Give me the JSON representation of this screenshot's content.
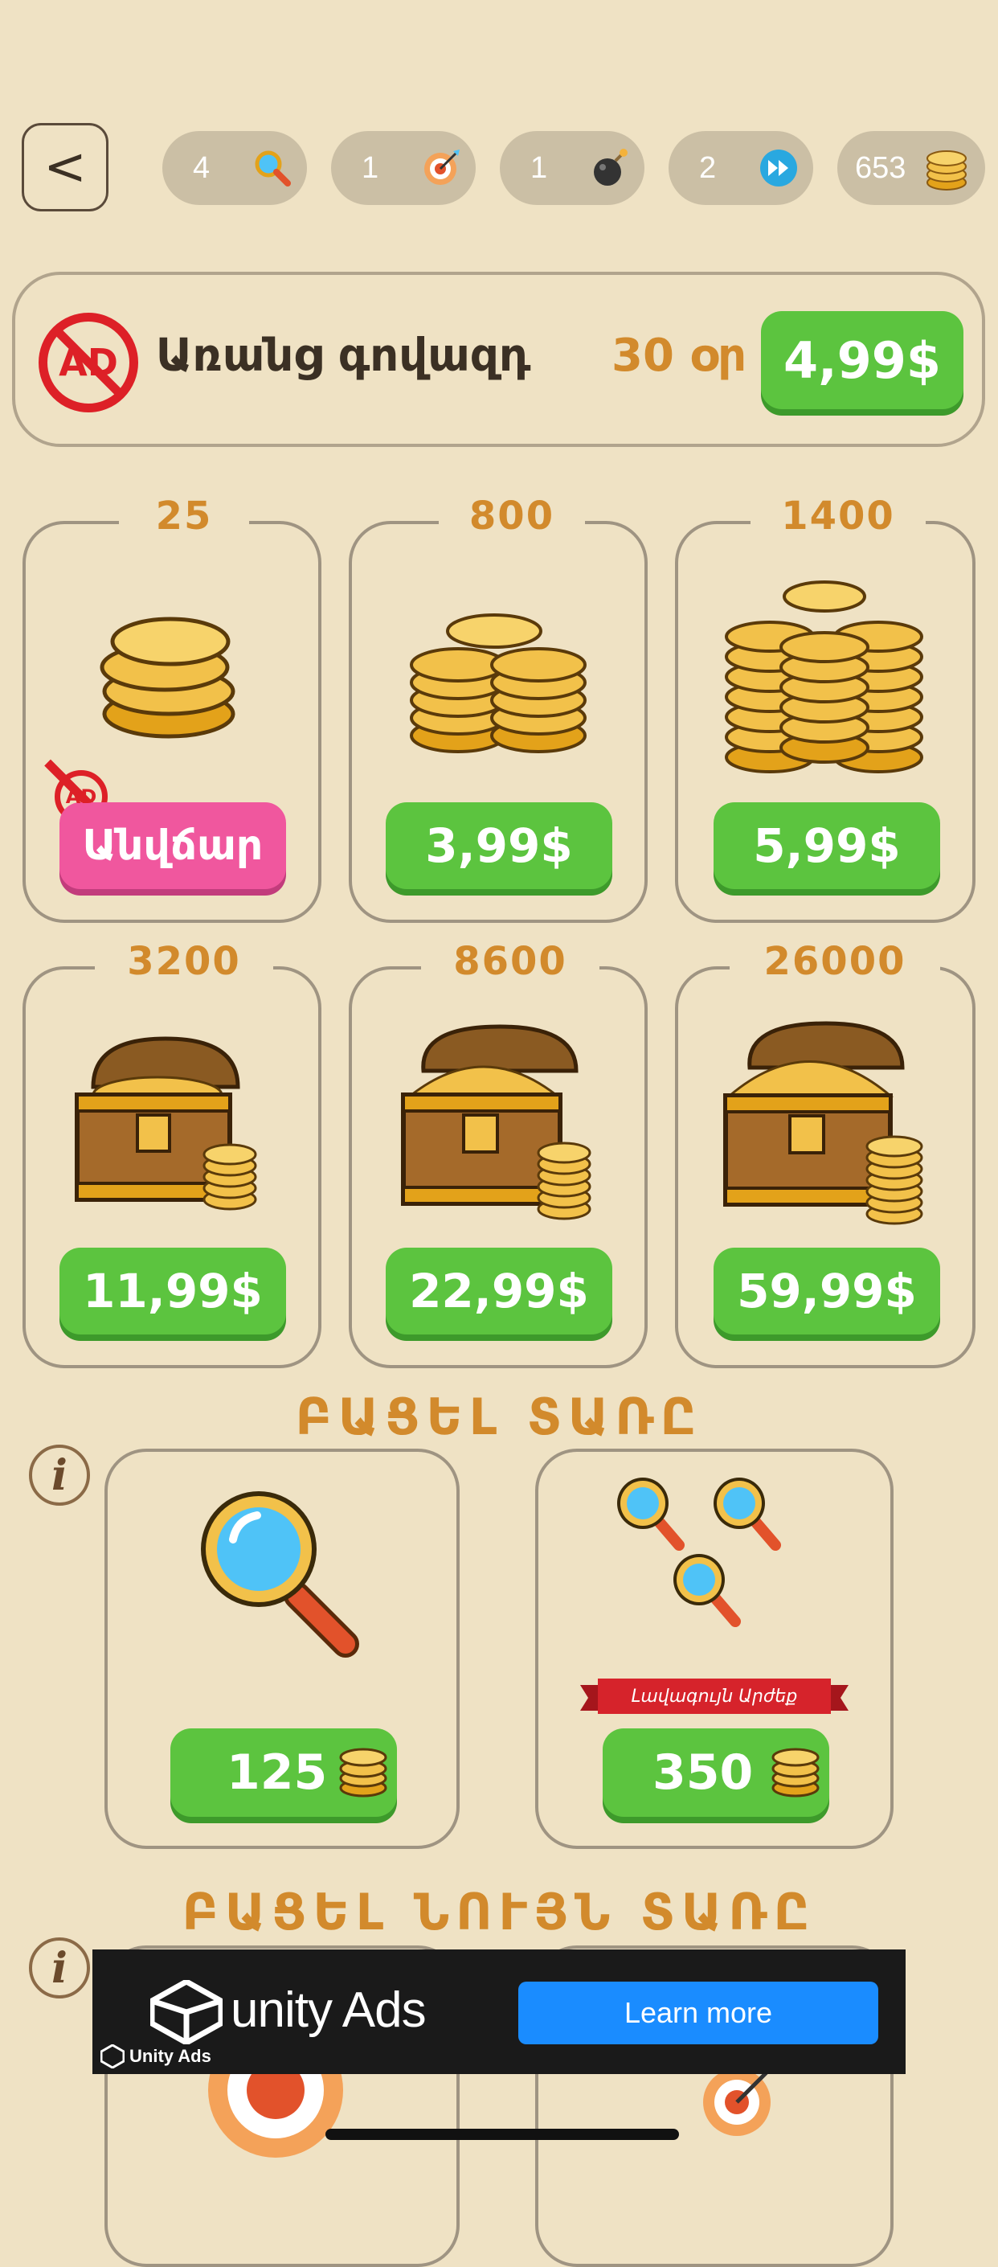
{
  "header": {
    "back_label": "<",
    "counters": [
      {
        "value": "4",
        "icon": "magnifier-icon"
      },
      {
        "value": "1",
        "icon": "target-icon"
      },
      {
        "value": "1",
        "icon": "bomb-icon"
      },
      {
        "value": "2",
        "icon": "fast-forward-icon"
      },
      {
        "value": "653",
        "icon": "coin-stack-icon"
      }
    ]
  },
  "no_ads": {
    "badge": "AD",
    "label": "Առանց գովազդ",
    "duration": "30 օր",
    "price": "4,99$"
  },
  "coin_packs": [
    {
      "amount": "25",
      "price": "Անվճար",
      "free": true,
      "ad_badge": "AD"
    },
    {
      "amount": "800",
      "price": "3,99$"
    },
    {
      "amount": "1400",
      "price": "5,99$"
    },
    {
      "amount": "3200",
      "price": "11,99$"
    },
    {
      "amount": "8600",
      "price": "22,99$"
    },
    {
      "amount": "26000",
      "price": "59,99$"
    }
  ],
  "open_letter": {
    "title": "ԲԱՑԵԼ ՏԱՌԸ",
    "info_icon": "i",
    "items": [
      {
        "price": "125"
      },
      {
        "price": "350",
        "ribbon": "Լավագույն Արժեք"
      }
    ]
  },
  "open_same_letter": {
    "title": "ԲԱՑԵԼ ՆՈՒՅՆ ՏԱՌԸ",
    "info_icon": "i"
  },
  "ad_banner": {
    "brand": "unity Ads",
    "small_brand": "Unity Ads",
    "cta": "Learn more"
  },
  "colors": {
    "background": "#efe2c4",
    "accent_gold": "#d28a2c",
    "button_green": "#5cc43f",
    "free_pink": "#f0579e",
    "ad_red": "#dd2027"
  }
}
